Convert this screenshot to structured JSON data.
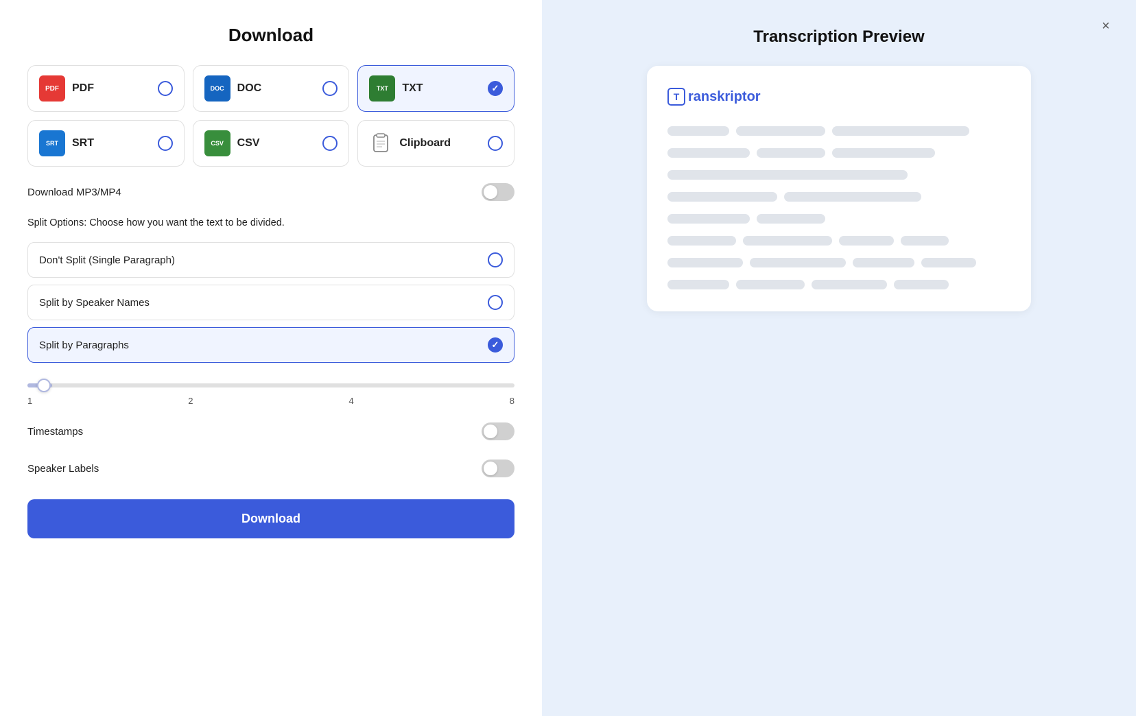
{
  "left": {
    "title": "Download",
    "formats": [
      {
        "id": "pdf",
        "label": "PDF",
        "type": "pdf",
        "selected": false
      },
      {
        "id": "doc",
        "label": "DOC",
        "type": "doc",
        "selected": false
      },
      {
        "id": "txt",
        "label": "TXT",
        "type": "txt",
        "selected": true
      },
      {
        "id": "srt",
        "label": "SRT",
        "type": "srt",
        "selected": false
      },
      {
        "id": "csv",
        "label": "CSV",
        "type": "csv",
        "selected": false
      },
      {
        "id": "clipboard",
        "label": "Clipboard",
        "type": "clipboard",
        "selected": false
      }
    ],
    "mp3mp4_label": "Download MP3/MP4",
    "mp3mp4_on": false,
    "split_section_label": "Split Options: Choose how you want the text to be divided.",
    "split_options": [
      {
        "id": "no-split",
        "label": "Don't Split (Single Paragraph)",
        "selected": false
      },
      {
        "id": "by-speaker",
        "label": "Split by Speaker Names",
        "selected": false
      },
      {
        "id": "by-paragraphs",
        "label": "Split by Paragraphs",
        "selected": true
      }
    ],
    "slider": {
      "min": 1,
      "max": 8,
      "value": 1,
      "ticks": [
        "1",
        "2",
        "4",
        "8"
      ]
    },
    "timestamps_label": "Timestamps",
    "timestamps_on": false,
    "speaker_labels_label": "Speaker Labels",
    "speaker_labels_on": false,
    "download_btn_label": "Download"
  },
  "right": {
    "close_icon": "×",
    "title": "Transcription Preview",
    "logo_letter": "T",
    "logo_text": "ranskriptor",
    "skeleton_rows": [
      [
        90,
        130,
        110
      ],
      [
        120,
        100,
        130
      ],
      [
        130,
        90
      ],
      [
        160,
        130
      ],
      [
        120,
        100
      ],
      [
        100,
        130,
        90,
        70
      ],
      [
        110,
        140,
        120,
        80
      ],
      [
        120,
        100,
        110
      ]
    ]
  }
}
